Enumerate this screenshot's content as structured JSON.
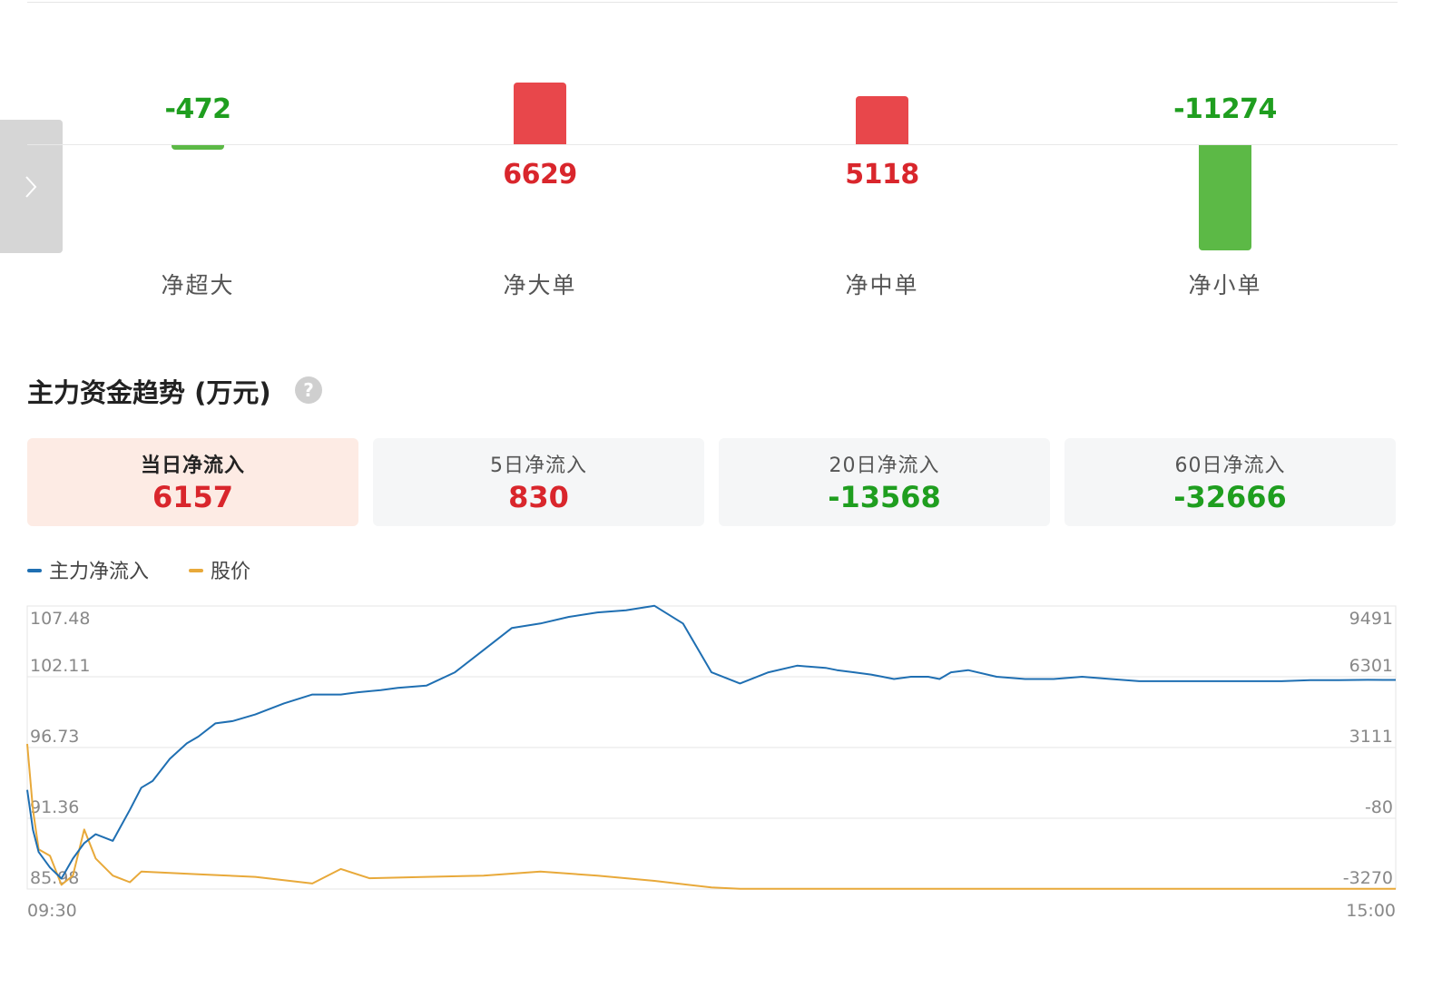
{
  "flow_bars": [
    {
      "label": "净超大",
      "value": -472,
      "value_text": "-472"
    },
    {
      "label": "净大单",
      "value": 6629,
      "value_text": "6629"
    },
    {
      "label": "净中单",
      "value": 5118,
      "value_text": "5118"
    },
    {
      "label": "净小单",
      "value": -11274,
      "value_text": "-11274"
    }
  ],
  "section_title": "主力资金趋势 (万元)",
  "help_icon": "help-icon",
  "side_tab_icon": "chevron-right-icon",
  "tabs": [
    {
      "label": "当日净流入",
      "value": "6157",
      "active": true,
      "sign": "positive"
    },
    {
      "label": "5日净流入",
      "value": "830",
      "active": false,
      "sign": "positive"
    },
    {
      "label": "20日净流入",
      "value": "-13568",
      "active": false,
      "sign": "negative"
    },
    {
      "label": "60日净流入",
      "value": "-32666",
      "active": false,
      "sign": "negative"
    }
  ],
  "colors": {
    "positive": "#d9262c",
    "negative": "#1f9e1f",
    "bar_positive": "#e8474b",
    "bar_negative": "#5cb946",
    "main_flow_line": "#1f6fb2",
    "price_line": "#e8a93a",
    "active_tab_bg": "#fdebe4"
  },
  "chart_data": {
    "type": "line",
    "legend": [
      {
        "name": "主力净流入",
        "color": "#1f6fb2"
      },
      {
        "name": "股价",
        "color": "#e8a93a"
      }
    ],
    "left_axis_ticks": [
      "107.48",
      "102.11",
      "96.73",
      "91.36",
      "85.98"
    ],
    "right_axis_ticks": [
      "9491",
      "6301",
      "3111",
      "-80",
      "-3270"
    ],
    "x_ticks": [
      "09:30",
      "15:00"
    ],
    "left_ylim": [
      85.98,
      107.48
    ],
    "right_ylim": [
      -3270,
      9491
    ],
    "series": [
      {
        "name": "主力净流入",
        "axis": "right",
        "x": [
          0,
          1,
          2,
          4,
          6,
          8,
          10,
          12,
          15,
          18,
          20,
          22,
          25,
          28,
          30,
          33,
          36,
          40,
          45,
          50,
          55,
          58,
          62,
          65,
          70,
          75,
          80,
          85,
          90,
          95,
          100,
          105,
          110,
          115,
          120,
          125,
          130,
          135,
          140,
          142,
          145,
          148,
          150,
          152,
          155,
          158,
          160,
          162,
          165,
          170,
          175,
          180,
          185,
          190,
          195,
          200,
          205,
          210,
          215,
          220,
          225,
          230,
          235,
          240
        ],
        "values": [
          1200,
          -600,
          -1600,
          -2300,
          -2800,
          -1900,
          -1200,
          -800,
          -1100,
          300,
          1300,
          1600,
          2600,
          3300,
          3600,
          4200,
          4300,
          4600,
          5100,
          5500,
          5500,
          5600,
          5700,
          5800,
          5900,
          6500,
          7500,
          8500,
          8700,
          9000,
          9200,
          9300,
          9500,
          8700,
          6500,
          6000,
          6500,
          6800,
          6700,
          6600,
          6500,
          6400,
          6300,
          6200,
          6300,
          6300,
          6200,
          6500,
          6600,
          6300,
          6200,
          6200,
          6300,
          6200,
          6100,
          6100,
          6100,
          6100,
          6100,
          6100,
          6150,
          6150,
          6160,
          6157
        ]
      },
      {
        "name": "股价",
        "axis": "left",
        "x": [
          0,
          1,
          2,
          4,
          6,
          8,
          10,
          12,
          15,
          18,
          20,
          25,
          30,
          40,
          50,
          55,
          60,
          70,
          80,
          90,
          100,
          110,
          120,
          125,
          130,
          150,
          180,
          200,
          240
        ],
        "values": [
          97.0,
          92.0,
          89.0,
          88.5,
          86.3,
          87.0,
          90.5,
          88.3,
          87.0,
          86.5,
          87.3,
          87.2,
          87.1,
          86.9,
          86.4,
          87.5,
          86.8,
          86.9,
          87.0,
          87.3,
          87.0,
          86.6,
          86.1,
          86.0,
          86.0,
          86.0,
          86.0,
          86.0,
          86.0
        ]
      }
    ]
  }
}
